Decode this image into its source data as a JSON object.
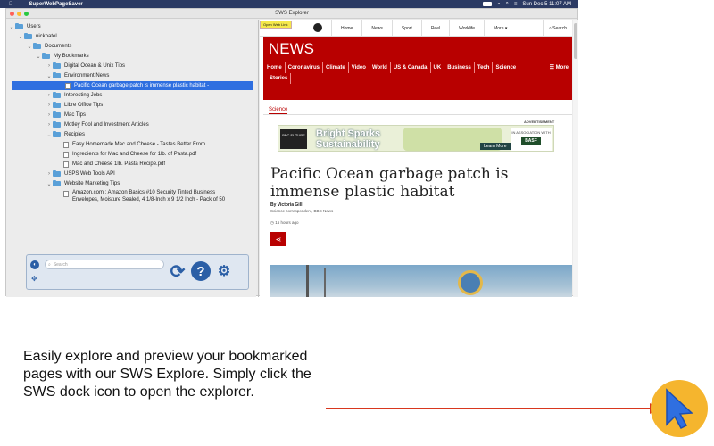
{
  "menubar": {
    "app_name": "SuperWebPageSaver",
    "date_time": "Sun Dec 5  11:07 AM"
  },
  "window": {
    "title": "SWS Explorer"
  },
  "tree": {
    "users": "Users",
    "nickpatel": "nickpatel",
    "documents": "Documents",
    "my_bookmarks": "My Bookmarks",
    "digital_ocean": "Digital Ocean & Unix Tips",
    "environment_news": "Environment News",
    "pacific_file": "Pacific Ocean garbage patch is immense plastic habitat -",
    "interesting_jobs": "Interesting Jobs",
    "libre_office": "Libre Office Tips",
    "mac_tips": "Mac Tips",
    "motley_fool": "Motley Fool and Investment Articles",
    "recipies": "Recipies",
    "recipe_1": "Easy Homemade Mac and Cheese - Tastes Better From",
    "recipe_2": "Ingredients for Mac and Cheese for 1lb. of Pasta.pdf",
    "recipe_3": "Mac and Cheese 1lb. Pasta Recipe.pdf",
    "usps": "USPS Web Tools API",
    "website_marketing": "Website Marketing Tips",
    "amazon_line1": "Amazon.com : Amazon Basics #10 Security Tinted Business",
    "amazon_line2": "Envelopes, Moisture Sealed, 4 1/8-Inch x 9 1/2 Inch - Pack of 50"
  },
  "toolbox": {
    "search_placeholder": "Search"
  },
  "browser": {
    "open_link_label": "Open Web Link",
    "nav": [
      "Home",
      "News",
      "Sport",
      "Reel",
      "Worklife",
      "More ▾"
    ],
    "search_label": "Search",
    "brand": "NEWS",
    "news_nav": [
      "Home",
      "Coronavirus",
      "Climate",
      "Video",
      "World",
      "US & Canada",
      "UK",
      "Business",
      "Tech",
      "Science",
      "Stories"
    ],
    "more_label": "☰ More",
    "section": "Science",
    "ad_label": "ADVERTISEMENT",
    "ad_brand": "BBC FUTURE",
    "ad_headline_1": "Bright Sparks",
    "ad_headline_2": "Sustainability",
    "ad_learn_more": "Learn More",
    "ad_partner_text": "IN ASSOCIATION WITH",
    "ad_partner": "BASF",
    "article_title": "Pacific Ocean garbage patch is immense plastic habitat",
    "byline": "By Victoria Gill",
    "byline_role": "Science correspondent, BBC News",
    "timestamp": "15 hours ago"
  },
  "caption": "Easily explore and preview your bookmarked pages with our SWS Explore. Simply click the SWS dock icon to open the explorer.",
  "colors": {
    "bbc_red": "#b80000",
    "selection_blue": "#2f6fe0",
    "arrow_red": "#d8371e",
    "dock_icon_yellow": "#f5b52e",
    "dock_icon_blue": "#2f6fe0"
  }
}
